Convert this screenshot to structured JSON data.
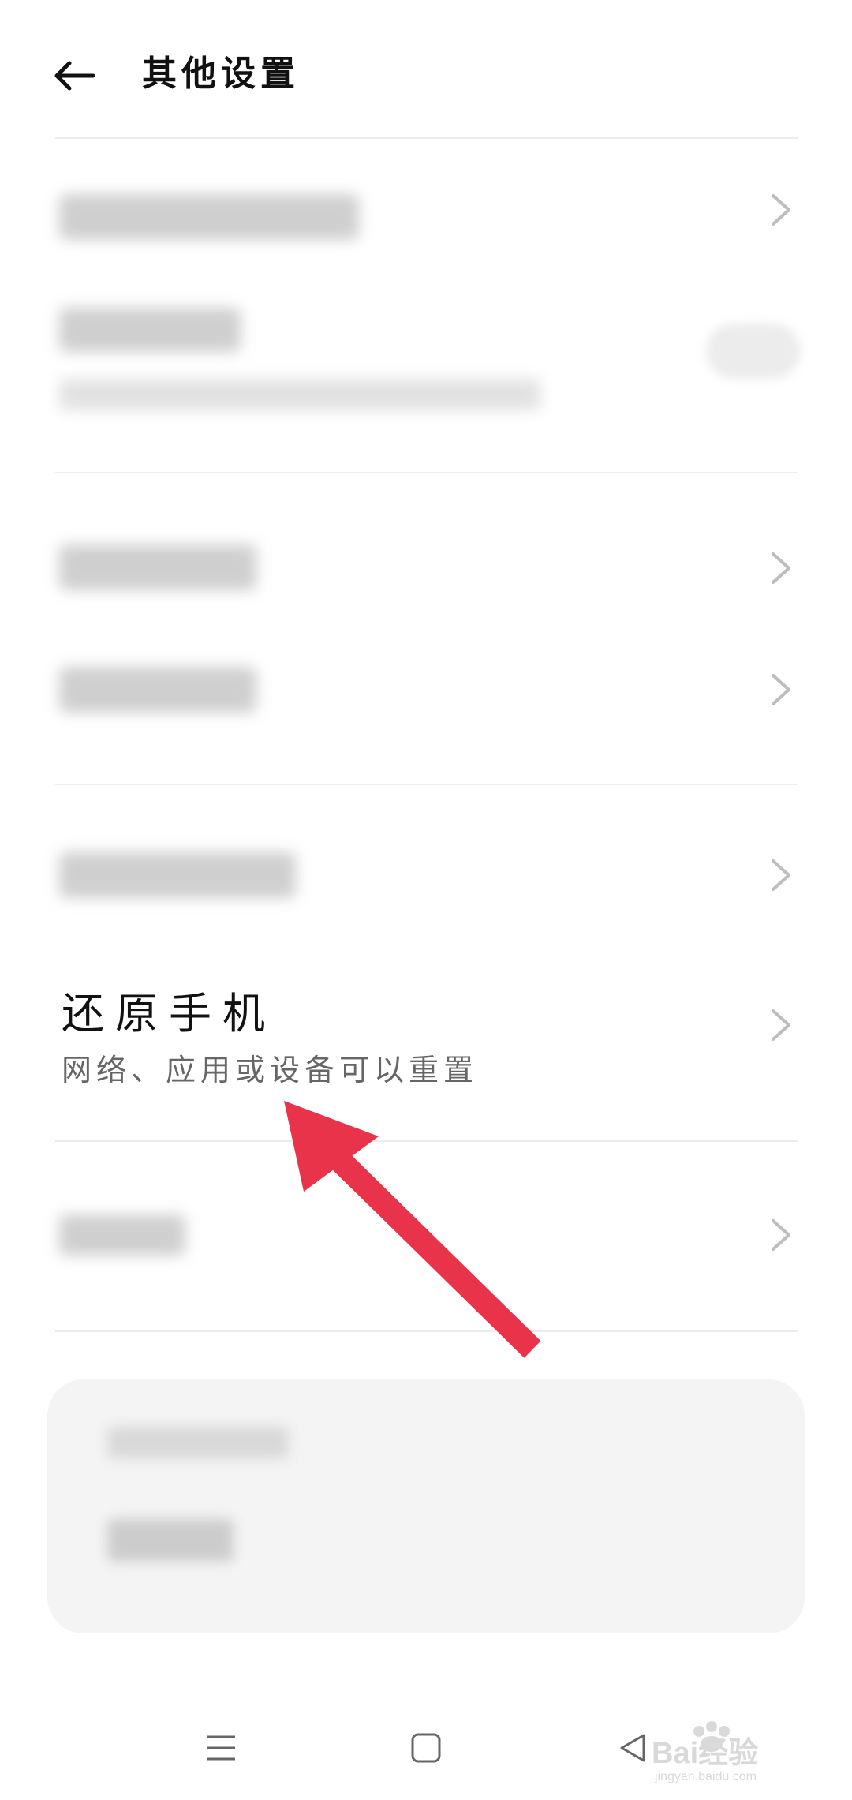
{
  "header": {
    "title": "其他设置"
  },
  "rows": {
    "row1": {
      "label": ""
    },
    "row2": {
      "label": "",
      "sublabel": ""
    },
    "row3": {
      "label": ""
    },
    "row4": {
      "label": ""
    },
    "row5": {
      "label": ""
    },
    "reset_phone": {
      "title": "还原手机",
      "subtitle": "网络、应用或设备可以重置"
    },
    "row7": {
      "label": ""
    }
  },
  "bottom_card": {
    "line1": "",
    "line2": ""
  },
  "colors": {
    "annotation_arrow": "#e8334a",
    "divider": "#ececec",
    "card_bg": "#f4f4f4"
  },
  "icons": {
    "back": "arrow-left-icon",
    "chevron": "chevron-right-icon",
    "nav_menu": "menu-icon",
    "nav_home": "home-icon",
    "nav_back": "back-triangle-icon"
  },
  "watermark": {
    "text": "Bai经验",
    "subtext": "jingyan.baidu.com"
  }
}
